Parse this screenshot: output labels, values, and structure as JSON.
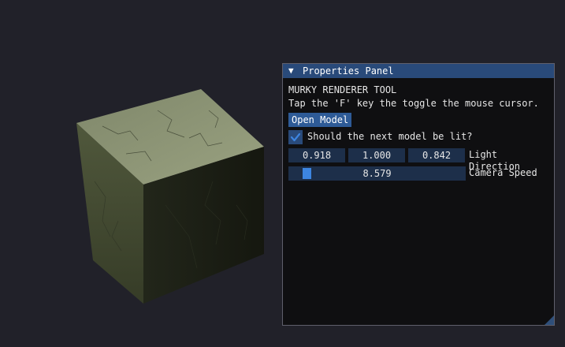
{
  "panel": {
    "title": "Properties Panel",
    "collapse_glyph": "▼",
    "heading": "MURKY RENDERER TOOL",
    "hint": "Tap the 'F' key the toggle the mouse cursor.",
    "open_model_label": "Open Model",
    "lit_checkbox": {
      "label": "Should the next model be lit?",
      "checked": true
    },
    "light_direction": {
      "values": [
        "0.918",
        "1.000",
        "0.842"
      ],
      "label": "Light Direction"
    },
    "camera_speed": {
      "value": "8.579",
      "label": "Camera Speed"
    }
  },
  "colors": {
    "viewport_bg": "#212129",
    "panel_bg": "#0f0f11",
    "titlebar": "#294a7a",
    "button": "#2e5b97",
    "field_bg": "#1d2f4a",
    "accent": "#3d85e0",
    "cube_top": "#8a9274",
    "cube_left": "#4a5238",
    "cube_right": "#1a1d14"
  },
  "icons": {
    "collapse": "triangle-down-icon",
    "check": "checkmark-icon",
    "resize": "resize-grip-icon"
  }
}
